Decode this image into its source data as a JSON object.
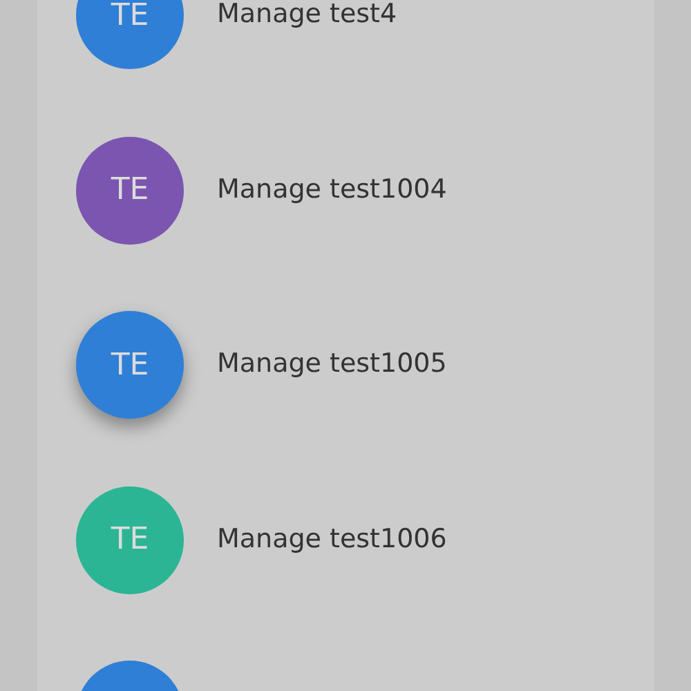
{
  "items": [
    {
      "initials": "TE",
      "label": "Manage test4",
      "color": "#2f7fd6",
      "selected": false
    },
    {
      "initials": "TE",
      "label": "Manage test1004",
      "color": "#7b55b0",
      "selected": false
    },
    {
      "initials": "TE",
      "label": "Manage test1005",
      "color": "#2f7fd6",
      "selected": true
    },
    {
      "initials": "TE",
      "label": "Manage test1006",
      "color": "#2bb594",
      "selected": false
    },
    {
      "color": "#2f7fd6",
      "selected": false
    }
  ]
}
